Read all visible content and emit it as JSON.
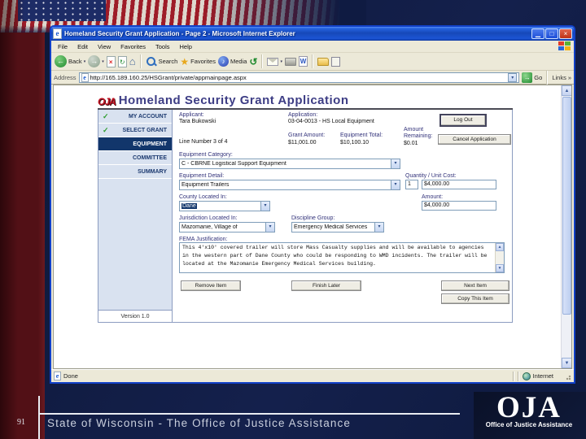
{
  "slide": {
    "number": "91",
    "footer": "State of Wisconsin - The Office of Justice Assistance",
    "logo_text": "OJA",
    "logo_subtext": "Office of Justice Assistance"
  },
  "browser": {
    "title": "Homeland Security Grant Application - Page 2 - Microsoft Internet Explorer",
    "menu": [
      "File",
      "Edit",
      "View",
      "Favorites",
      "Tools",
      "Help"
    ],
    "toolbar": {
      "back": "Back",
      "search": "Search",
      "favorites": "Favorites",
      "media": "Media"
    },
    "address_label": "Address",
    "url": "http://165.189.160.25/HSGrant/private/appmainpage.aspx",
    "go_label": "Go",
    "links_label": "Links",
    "status_done": "Done",
    "status_zone": "Internet",
    "window_buttons": {
      "minimize": "▁",
      "maximize": "□",
      "close": "×"
    }
  },
  "app": {
    "logo": "OJA",
    "title": "Homeland Security Grant Application",
    "nav": [
      {
        "label": "MY ACCOUNT"
      },
      {
        "label": "SELECT GRANT"
      },
      {
        "label": "EQUIPMENT"
      },
      {
        "label": "COMMITTEE"
      },
      {
        "label": "SUMMARY"
      }
    ],
    "version": "Version 1.0",
    "header": {
      "applicant_label": "Applicant:",
      "applicant": "Tara Bukowski",
      "application_label": "Application:",
      "application": "03-04-0013 - HS Local Equipment",
      "line_number": "Line Number 3 of 4",
      "grant_amount_label": "Grant Amount:",
      "grant_amount": "$11,001.00",
      "equipment_total_label": "Equipment Total:",
      "equipment_total": "$10,100.10",
      "amount_remaining_label_1": "Amount",
      "amount_remaining_label_2": "Remaining:",
      "amount_remaining": "$0.01",
      "logout_label": "Log Out",
      "cancel_label": "Cancel Application"
    },
    "form": {
      "equipment_category_label": "Equipment Category:",
      "equipment_category": "C - CBRNE Logistical Support Equipment",
      "equipment_detail_label": "Equipment Detail:",
      "equipment_detail": "Equipment Trailers",
      "quantity_unit_cost_label": "Quantity / Unit Cost:",
      "quantity": "1",
      "unit_cost": "$4,000.00",
      "county_label": "County Located In:",
      "county": "Dane",
      "amount_label": "Amount:",
      "amount": "$4,000.00",
      "jurisdiction_label": "Jurisdiction Located In:",
      "jurisdiction": "Mazomanie, Village of",
      "discipline_label": "Discipline Group:",
      "discipline": "Emergency Medical Services",
      "justification_label": "FEMA Justification:",
      "justification": "This 4'x10' covered trailer will store Mass Casualty supplies and will be available to agencies in the western part of Dane County who could be responding to WMD incidents.  The trailer will be located at the Mazomanie Emergency Medical Services building."
    },
    "buttons": {
      "remove": "Remove Item",
      "finish_later": "Finish Later",
      "next": "Next Item",
      "copy": "Copy This Item"
    }
  },
  "icons": {
    "check": "✓",
    "dropdown": "▾",
    "scroll_up": "▲",
    "scroll_down": "▼",
    "back_arrow": "←",
    "forward_arrow": "→",
    "stop_x": "×",
    "refresh": "↻",
    "home": "⌂",
    "star": "★",
    "note": "♪",
    "history": "↺",
    "go_arrow": "→",
    "links_chevron": "»",
    "ie_e": "e"
  },
  "colors": {
    "slide_navy": "#14204c",
    "strip_maroon": "#521016",
    "titlebar_blue": "#1c55d4",
    "toolbar_beige": "#ece9d8",
    "nav_active": "#12366b",
    "check_green": "#2f9e2f",
    "app_title": "#3d3d85",
    "flag_red": "#9e1c28"
  }
}
